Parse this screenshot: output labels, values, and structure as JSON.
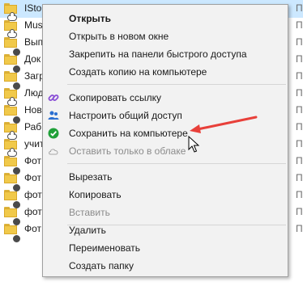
{
  "files": [
    {
      "name": "IStore",
      "type": "Па",
      "selected": true
    },
    {
      "name": "Mus",
      "type": "Па",
      "selected": false
    },
    {
      "name": "Вып",
      "type": "Па",
      "selected": false
    },
    {
      "name": "Док",
      "type": "Па",
      "selected": false
    },
    {
      "name": "Загр",
      "type": "Па",
      "selected": false
    },
    {
      "name": "Люд",
      "type": "Па",
      "selected": false
    },
    {
      "name": "Нов",
      "type": "Па",
      "selected": false
    },
    {
      "name": "Раб",
      "type": "Па",
      "selected": false
    },
    {
      "name": "учит",
      "type": "Па",
      "selected": false
    },
    {
      "name": "Фот",
      "type": "Па",
      "selected": false
    },
    {
      "name": "Фот",
      "type": "Па",
      "selected": false
    },
    {
      "name": "фот",
      "type": "Па",
      "selected": false
    },
    {
      "name": "фот",
      "type": "Па",
      "selected": false
    },
    {
      "name": "Фот",
      "type": "Па",
      "selected": false
    }
  ],
  "menu": {
    "open": "Открыть",
    "open_new_window": "Открыть в новом окне",
    "pin_quick_access": "Закрепить на панели быстрого доступа",
    "create_copy_on_computer": "Создать копию на компьютере",
    "copy_link": "Скопировать ссылку",
    "share": "Настроить общий доступ",
    "keep_on_device": "Сохранить на компьютере",
    "free_up_space": "Оставить только в облаке",
    "cut": "Вырезать",
    "copy": "Копировать",
    "paste": "Вставить",
    "delete": "Удалить",
    "rename": "Переименовать",
    "new_folder": "Создать папку"
  },
  "colors": {
    "selection": "#cce8ff",
    "menu_bg": "#f2f2f2",
    "annotation_arrow": "#e8403a",
    "share_icon": "#2b6fd1",
    "link_icon": "#8a4fd6",
    "check_icon": "#20a039"
  },
  "icons": {
    "copy_link": "link-icon",
    "share": "people-icon",
    "keep_on_device": "green-check-icon",
    "free_up_space": "cloud-outline-icon"
  }
}
